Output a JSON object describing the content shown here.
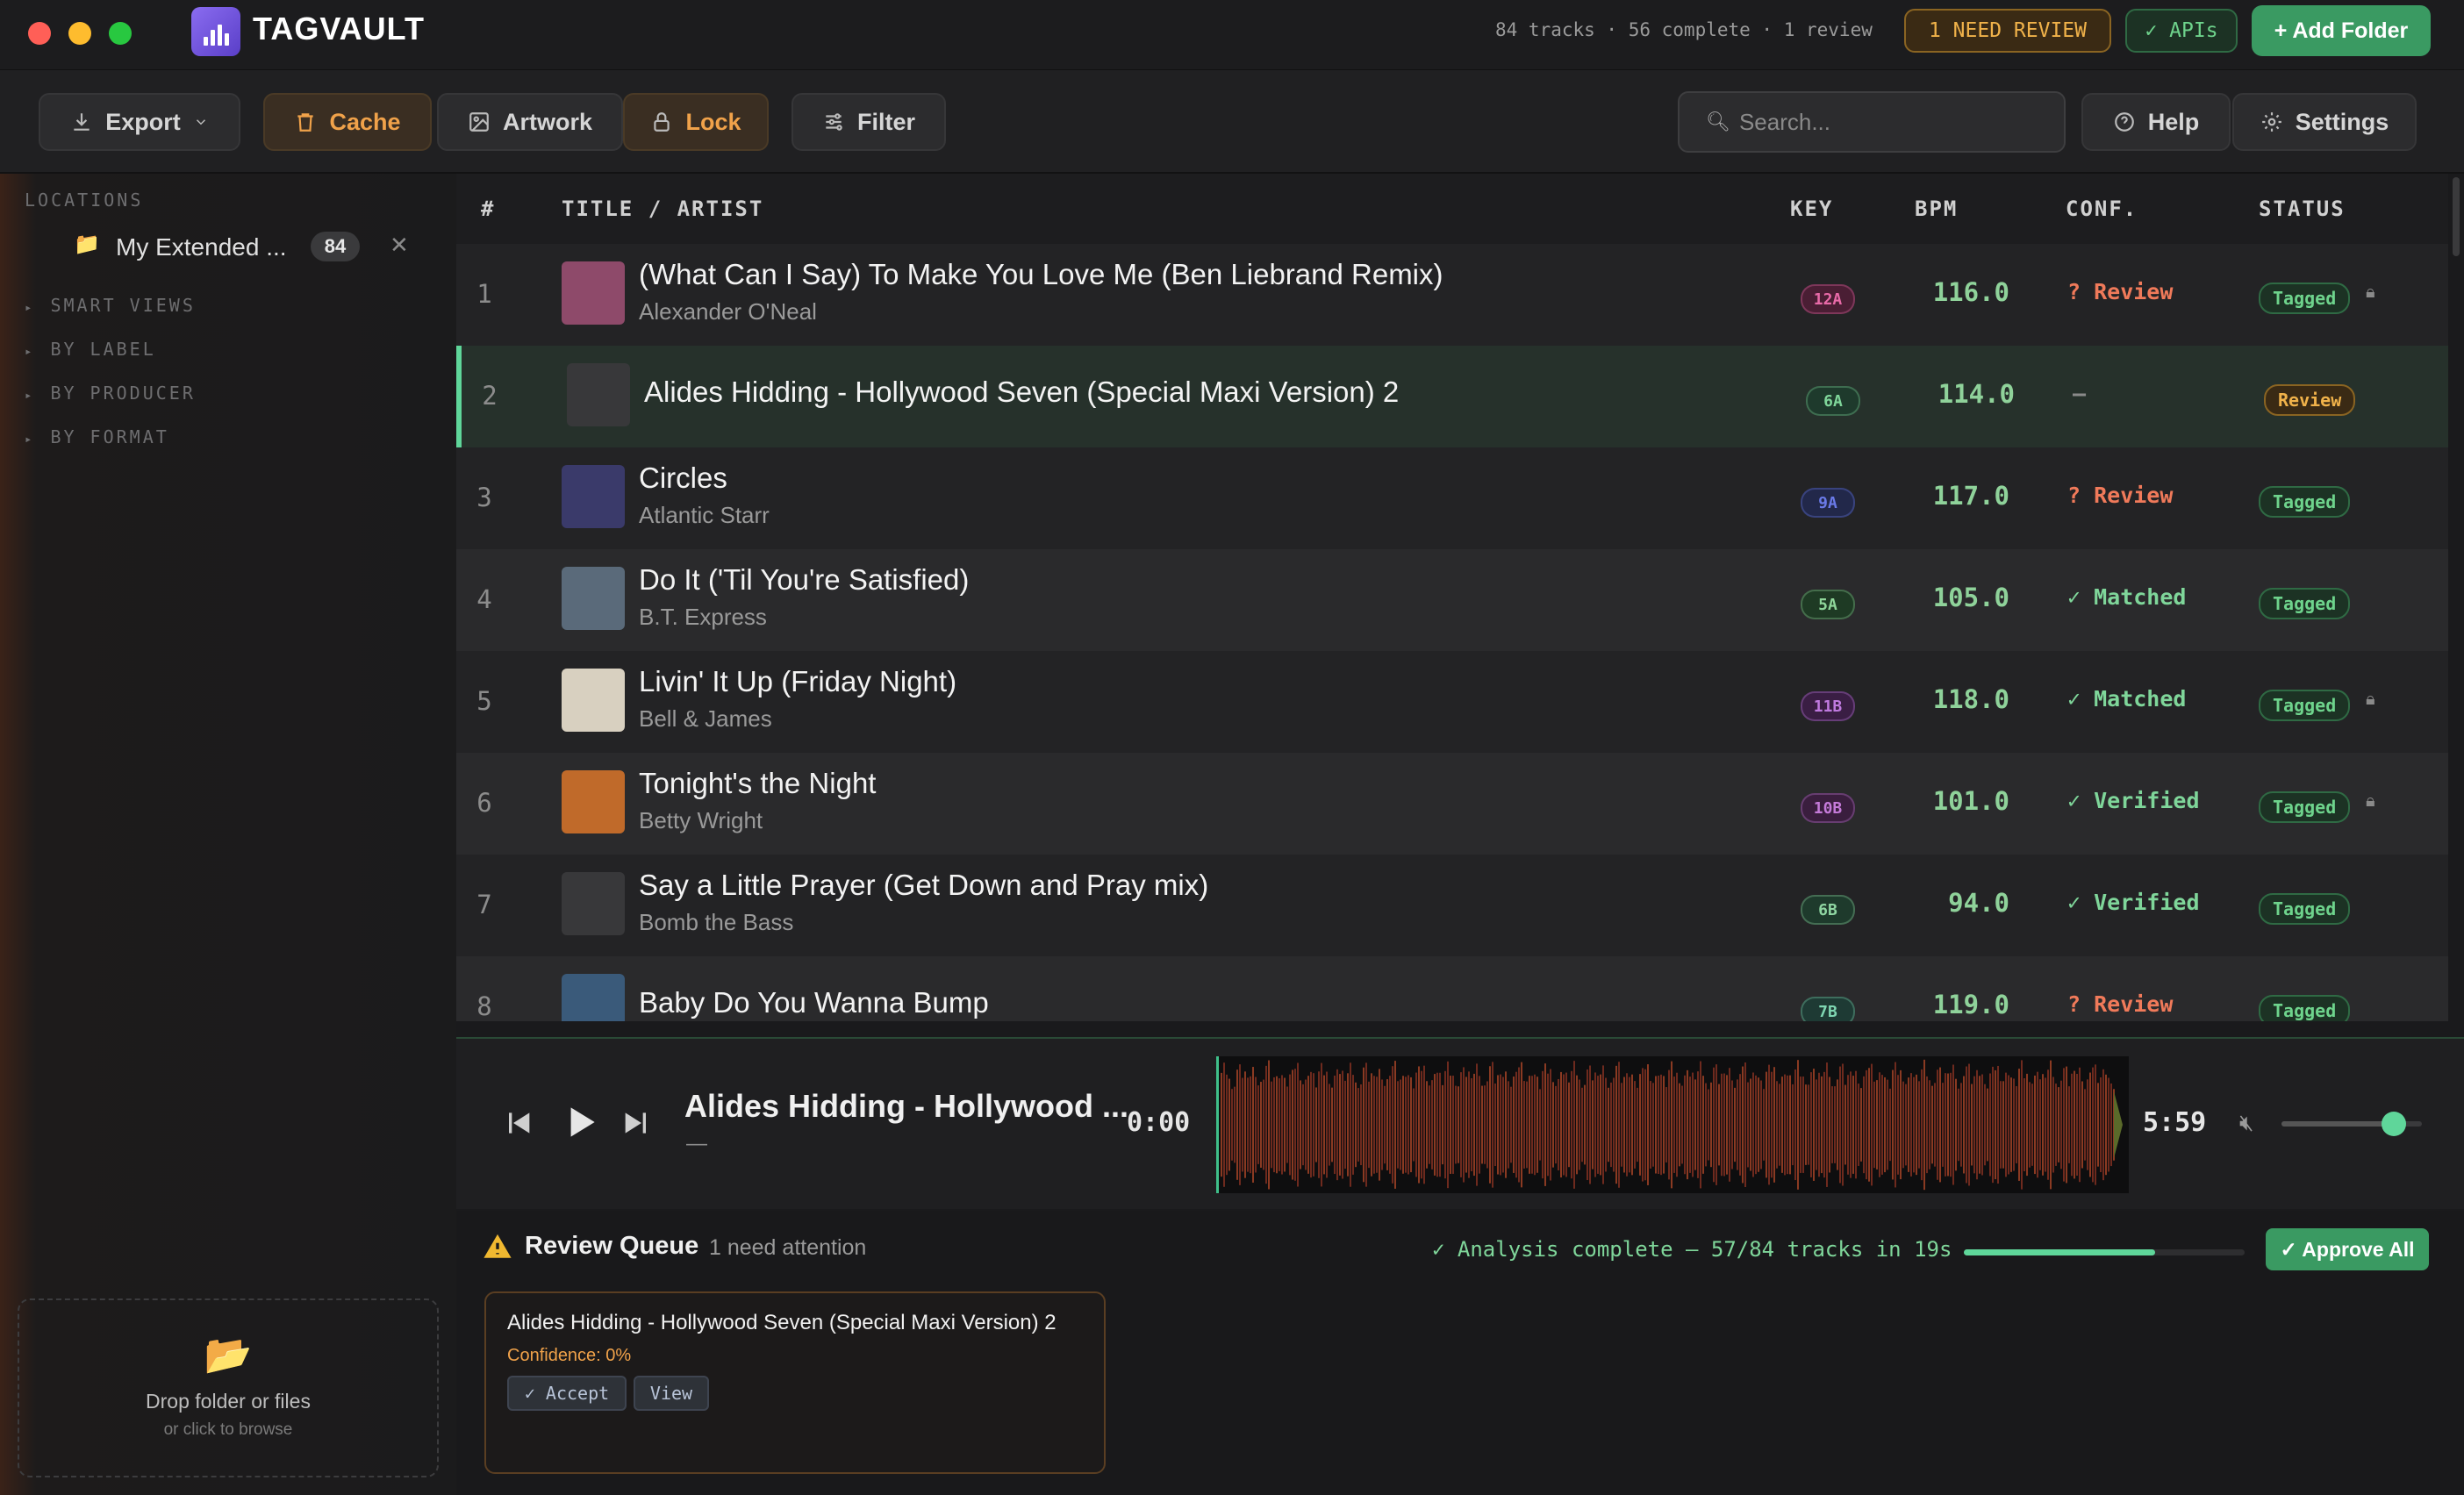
{
  "app": {
    "name": "TAGVAULT",
    "stats": "84 tracks · 56 complete · 1 review",
    "need_review": "1 NEED REVIEW",
    "apis": "✓ APIs",
    "add_folder": "+ Add Folder"
  },
  "toolbar": {
    "export": "Export",
    "cache": "Cache",
    "artwork": "Artwork",
    "lock": "Lock",
    "filter": "Filter",
    "search_placeholder": "Search...",
    "help": "Help",
    "settings": "Settings"
  },
  "sidebar": {
    "locations_title": "LOCATIONS",
    "location_name": "My Extended ...",
    "location_count": "84",
    "sections": [
      "SMART VIEWS",
      "BY LABEL",
      "BY PRODUCER",
      "BY FORMAT"
    ],
    "drop_title": "Drop folder or files",
    "drop_sub": "or click to browse"
  },
  "table": {
    "headers": {
      "num": "#",
      "title": "TITLE / ARTIST",
      "key": "KEY",
      "bpm": "BPM",
      "conf": "CONF.",
      "status": "STATUS"
    },
    "rows": [
      {
        "num": "1",
        "title": "(What Can I Say) To Make You Love Me (Ben Liebrand Remix)",
        "artist": "Alexander O'Neal",
        "key": "12A",
        "bpm": "116.0",
        "conf": "? Review",
        "status": "Tagged",
        "locked": true,
        "art": "#8e4a6a"
      },
      {
        "num": "2",
        "title": "Alides Hidding - Hollywood Seven (Special Maxi Version) 2",
        "artist": "",
        "key": "6A",
        "bpm": "114.0",
        "conf": "—",
        "status": "Review",
        "locked": false,
        "art": ""
      },
      {
        "num": "3",
        "title": "Circles",
        "artist": "Atlantic Starr",
        "key": "9A",
        "bpm": "117.0",
        "conf": "? Review",
        "status": "Tagged",
        "locked": false,
        "art": "#3a3a6a"
      },
      {
        "num": "4",
        "title": "Do It ('Til You're Satisfied)",
        "artist": "B.T. Express",
        "key": "5A",
        "bpm": "105.0",
        "conf": "✓ Matched",
        "status": "Tagged",
        "locked": false,
        "art": "#5a6a7a"
      },
      {
        "num": "5",
        "title": "Livin' It Up (Friday Night)",
        "artist": "Bell & James",
        "key": "11B",
        "bpm": "118.0",
        "conf": "✓ Matched",
        "status": "Tagged",
        "locked": true,
        "art": "#d8d0c0"
      },
      {
        "num": "6",
        "title": "Tonight's the Night",
        "artist": "Betty Wright",
        "key": "10B",
        "bpm": "101.0",
        "conf": "✓ Verified",
        "status": "Tagged",
        "locked": true,
        "art": "#c06a2a"
      },
      {
        "num": "7",
        "title": "Say a Little Prayer (Get Down and Pray mix)",
        "artist": "Bomb the Bass",
        "key": "6B",
        "bpm": "94.0",
        "conf": "✓ Verified",
        "status": "Tagged",
        "locked": false,
        "art": ""
      },
      {
        "num": "8",
        "title": "Baby Do You Wanna Bump",
        "artist": "",
        "key": "7B",
        "bpm": "119.0",
        "conf": "? Review",
        "status": "Tagged",
        "locked": false,
        "art": "#3a5a7a"
      }
    ]
  },
  "player": {
    "title": "Alides Hidding - Hollywood ...",
    "subtitle": "—",
    "elapsed": "0:00",
    "duration": "5:59",
    "volume": 0.8
  },
  "review": {
    "title": "Review Queue",
    "count": "1 need attention",
    "analysis": "✓ Analysis complete — 57/84 tracks in 19s",
    "progress": 0.68,
    "approve_all": "✓ Approve All",
    "card": {
      "title": "Alides Hidding - Hollywood Seven (Special Maxi Version) 2",
      "confidence": "Confidence: 0%",
      "accept": "✓ Accept",
      "view": "View"
    }
  }
}
